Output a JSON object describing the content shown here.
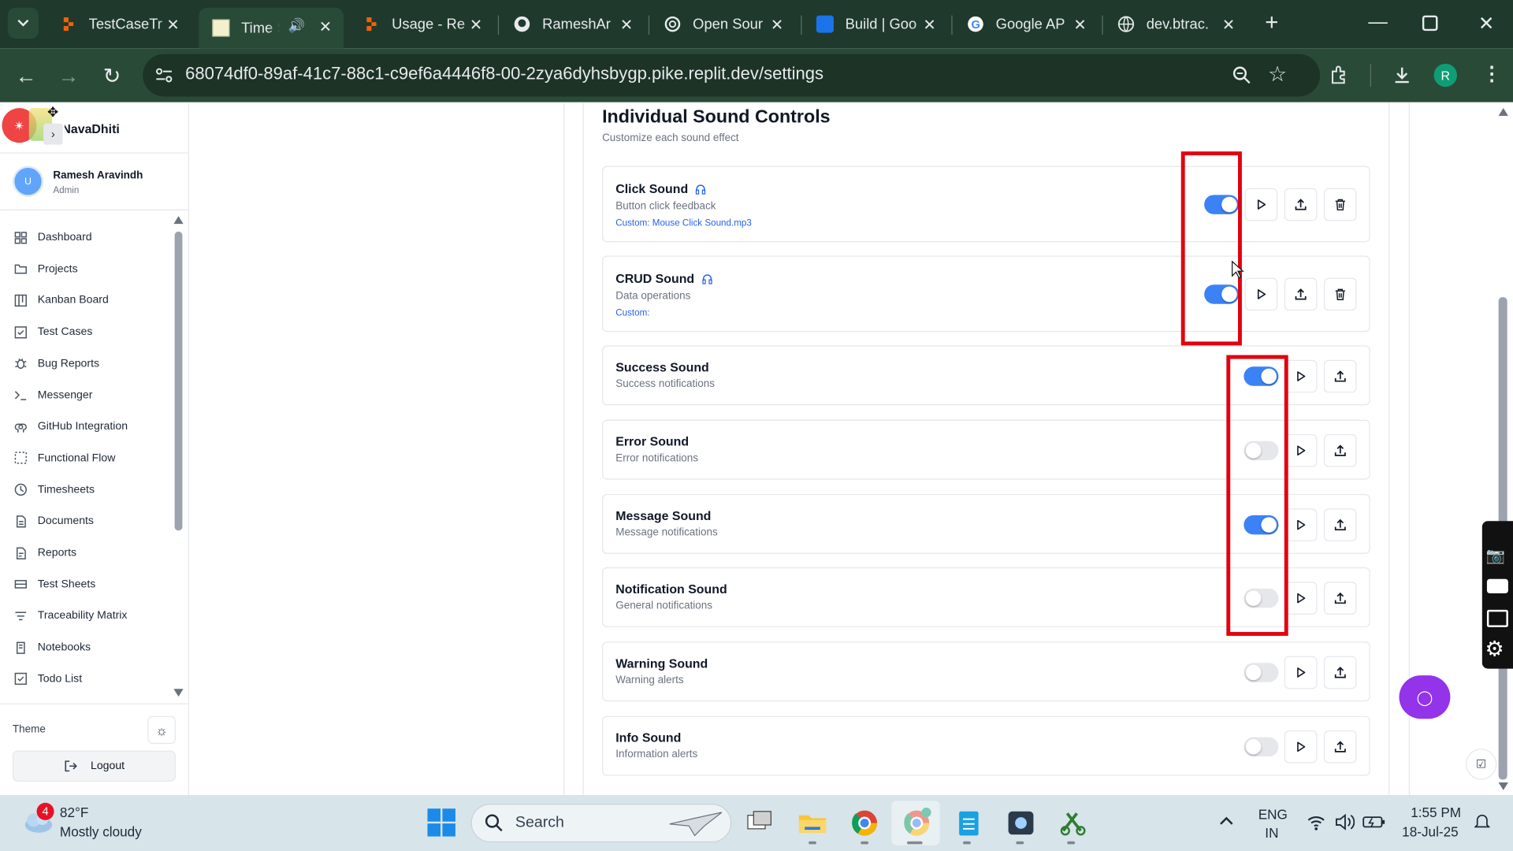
{
  "browser": {
    "tabs": [
      {
        "title": "TestCaseTr",
        "icon": "replit-icon"
      },
      {
        "title": "Time S",
        "icon": "app-favicon",
        "active": true
      },
      {
        "title": "Usage - Re",
        "icon": "replit-icon"
      },
      {
        "title": "RameshAr",
        "icon": "github-icon"
      },
      {
        "title": "Open Sour",
        "icon": "openai-icon"
      },
      {
        "title": "Build | Goo",
        "icon": "build-icon"
      },
      {
        "title": "Google AP",
        "icon": "google-icon"
      },
      {
        "title": "dev.btrac.",
        "icon": "globe-icon"
      }
    ],
    "url": "68074df0-89af-41c7-88c1-c9ef6a4446f8-00-2zya6dyhsbygp.pike.replit.dev/settings",
    "profile_initial": "R"
  },
  "sidebar": {
    "brand": "NavaDhiti",
    "user": {
      "name": "Ramesh Aravindh",
      "role": "Admin",
      "avatar_initial": "U"
    },
    "items": [
      {
        "label": "Dashboard",
        "icon": "grid-icon"
      },
      {
        "label": "Projects",
        "icon": "folder-icon"
      },
      {
        "label": "Kanban Board",
        "icon": "kanban-icon"
      },
      {
        "label": "Test Cases",
        "icon": "checkbox-icon"
      },
      {
        "label": "Bug Reports",
        "icon": "bug-icon"
      },
      {
        "label": "Messenger",
        "icon": "terminal-icon"
      },
      {
        "label": "GitHub Integration",
        "icon": "github-icon"
      },
      {
        "label": "Functional Flow",
        "icon": "flow-icon"
      },
      {
        "label": "Timesheets",
        "icon": "clock-icon"
      },
      {
        "label": "Documents",
        "icon": "document-icon"
      },
      {
        "label": "Reports",
        "icon": "report-icon"
      },
      {
        "label": "Test Sheets",
        "icon": "sheet-icon"
      },
      {
        "label": "Traceability Matrix",
        "icon": "filter-icon"
      },
      {
        "label": "Notebooks",
        "icon": "notebook-icon"
      },
      {
        "label": "Todo List",
        "icon": "todo-icon"
      }
    ],
    "theme_label": "Theme",
    "logout_label": "Logout"
  },
  "section": {
    "title": "Individual Sound Controls",
    "subtitle": "Customize each sound effect"
  },
  "sounds": [
    {
      "name": "Click Sound",
      "description": "Button click feedback",
      "custom": "Custom: Mouse Click Sound.mp3",
      "enabled": true,
      "has_custom": true
    },
    {
      "name": "CRUD Sound",
      "description": "Data operations",
      "custom": "Custom:",
      "enabled": true,
      "has_custom": true
    },
    {
      "name": "Success Sound",
      "description": "Success notifications",
      "custom": "",
      "enabled": true,
      "has_custom": false
    },
    {
      "name": "Error Sound",
      "description": "Error notifications",
      "custom": "",
      "enabled": false,
      "has_custom": false
    },
    {
      "name": "Message Sound",
      "description": "Message notifications",
      "custom": "",
      "enabled": true,
      "has_custom": false
    },
    {
      "name": "Notification Sound",
      "description": "General notifications",
      "custom": "",
      "enabled": false,
      "has_custom": false
    },
    {
      "name": "Warning Sound",
      "description": "Warning alerts",
      "custom": "",
      "enabled": false,
      "has_custom": false
    },
    {
      "name": "Info Sound",
      "description": "Information alerts",
      "custom": "",
      "enabled": false,
      "has_custom": false
    }
  ],
  "colors": {
    "toggle_on": "#3b82f6",
    "toggle_off": "#e5e7eb",
    "highlight": "#e3000f",
    "chat_button": "#9333ea"
  },
  "taskbar": {
    "weather_temp": "82°F",
    "weather_desc": "Mostly cloudy",
    "weather_badge": "4",
    "search_placeholder": "Search",
    "lang": "ENG",
    "region": "IN",
    "time": "1:55 PM",
    "date": "18-Jul-25"
  }
}
